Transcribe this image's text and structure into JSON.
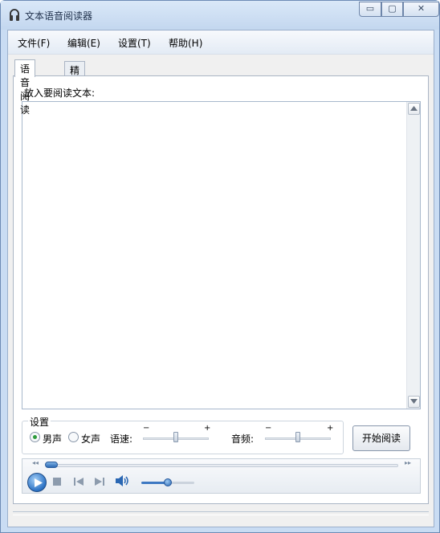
{
  "window": {
    "title": "文本语音阅读器",
    "controls": {
      "minimize": "▭",
      "maximize": "▢",
      "close": "✕"
    }
  },
  "menu": {
    "items": [
      "文件(F)",
      "编辑(E)",
      "设置(T)",
      "帮助(H)"
    ]
  },
  "tabs": [
    {
      "label": "语音阅读",
      "active": true
    },
    {
      "label": "精品软件",
      "active": false
    }
  ],
  "reader": {
    "prompt": "放入要阅读文本:",
    "text_value": ""
  },
  "settings": {
    "legend": "设置",
    "voices": [
      {
        "label": "男声",
        "checked": true
      },
      {
        "label": "女声",
        "checked": false
      }
    ],
    "speed": {
      "label": "语速:",
      "min_symbol": "−",
      "max_symbol": "+",
      "level": 0.5
    },
    "volume": {
      "label": "音频:",
      "min_symbol": "−",
      "max_symbol": "+",
      "level": 0.5
    },
    "start_button": "开始阅读"
  },
  "player": {
    "seek_level": 0.0,
    "volume_level": 0.5,
    "icons": [
      "rewind-icon",
      "play-icon",
      "stop-icon",
      "previous-icon",
      "next-icon",
      "speaker-icon",
      "fast-forward-icon"
    ]
  },
  "colors": {
    "title_bar": "#c3d7ef",
    "accent_blue": "#2a71c4",
    "radio_checked": "#2e9b3c"
  }
}
